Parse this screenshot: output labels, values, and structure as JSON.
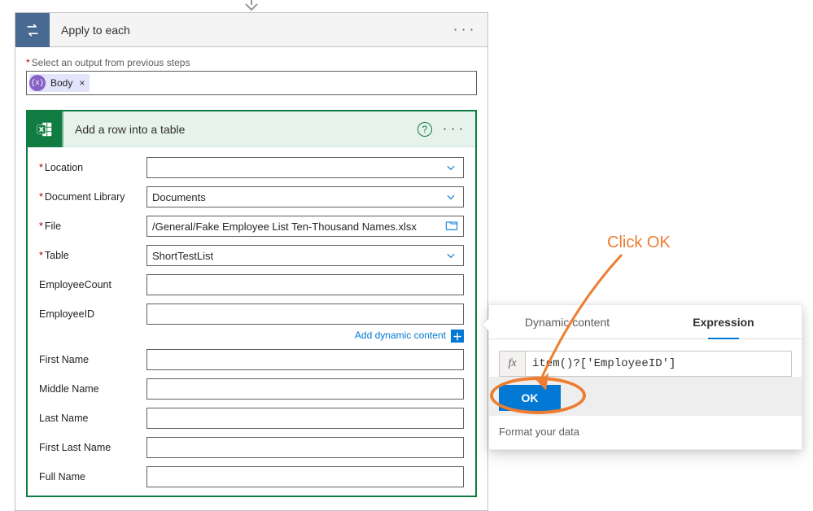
{
  "apply": {
    "title": "Apply to each",
    "outputs_label": "Select an output from previous steps",
    "body_token": "Body"
  },
  "excel": {
    "title": "Add a row into a table",
    "rows": [
      {
        "label": "Location",
        "required": true,
        "value": "",
        "kind": "dropdown"
      },
      {
        "label": "Document Library",
        "required": true,
        "value": "Documents",
        "kind": "dropdown"
      },
      {
        "label": "File",
        "required": true,
        "value": "/General/Fake Employee List Ten-Thousand Names.xlsx",
        "kind": "file"
      },
      {
        "label": "Table",
        "required": true,
        "value": "ShortTestList",
        "kind": "dropdown"
      },
      {
        "label": "EmployeeCount",
        "required": false,
        "value": "",
        "kind": "text"
      },
      {
        "label": "EmployeeID",
        "required": false,
        "value": "",
        "kind": "text"
      },
      {
        "label": "First Name",
        "required": false,
        "value": "",
        "kind": "text"
      },
      {
        "label": "Middle Name",
        "required": false,
        "value": "",
        "kind": "text"
      },
      {
        "label": "Last Name",
        "required": false,
        "value": "",
        "kind": "text"
      },
      {
        "label": "First Last Name",
        "required": false,
        "value": "",
        "kind": "text"
      },
      {
        "label": "Full Name",
        "required": false,
        "value": "",
        "kind": "text"
      }
    ],
    "add_dynamic": "Add dynamic content"
  },
  "popover": {
    "tab_dynamic": "Dynamic content",
    "tab_expression": "Expression",
    "fx_label": "fx",
    "expression": "item()?['EmployeeID']",
    "ok_label": "OK",
    "format_label": "Format your data"
  },
  "annotation": {
    "text": "Click OK"
  }
}
